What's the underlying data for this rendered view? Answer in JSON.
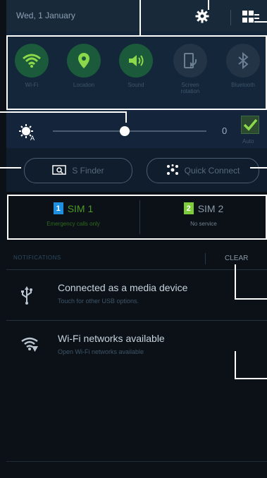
{
  "status_header": {
    "date": "Wed, 1 January"
  },
  "quick_toggles": [
    {
      "label": "Wi-Fi",
      "state": "on",
      "icon": "wifi-icon"
    },
    {
      "label": "Location",
      "state": "on",
      "icon": "location-pin-icon"
    },
    {
      "label": "Sound",
      "state": "on",
      "icon": "speaker-icon"
    },
    {
      "label": "Screen rotation",
      "state": "off",
      "icon": "rotation-icon"
    },
    {
      "label": "Bluetooth",
      "state": "off",
      "icon": "bluetooth-icon"
    }
  ],
  "brightness": {
    "value": "0",
    "auto_label": "Auto",
    "auto_checked": true,
    "level": 0.47
  },
  "action_buttons": {
    "s_finder": "S Finder",
    "quick_connect": "Quick Connect"
  },
  "sims": [
    {
      "badge": "1",
      "name": "SIM 1",
      "status": "Emergency calls only",
      "color": "#1f8fe0",
      "text_color": "#4a9a2a"
    },
    {
      "badge": "2",
      "name": "SIM 2",
      "status": "No service",
      "color": "#7fcc3a",
      "text_color": "#8a9aa8"
    }
  ],
  "notifications_header": {
    "title": "NOTIFICATIONS",
    "clear": "CLEAR"
  },
  "notifications": [
    {
      "title": "Connected as a media device",
      "text": "Touch for other USB options.",
      "icon": "usb-icon"
    },
    {
      "title": "Wi-Fi networks available",
      "text": "Open Wi-Fi networks available",
      "icon": "wifi-alert-icon"
    }
  ],
  "colors": {
    "toggle_on": "#8bd94a",
    "toggle_off": "#6a7f92"
  }
}
